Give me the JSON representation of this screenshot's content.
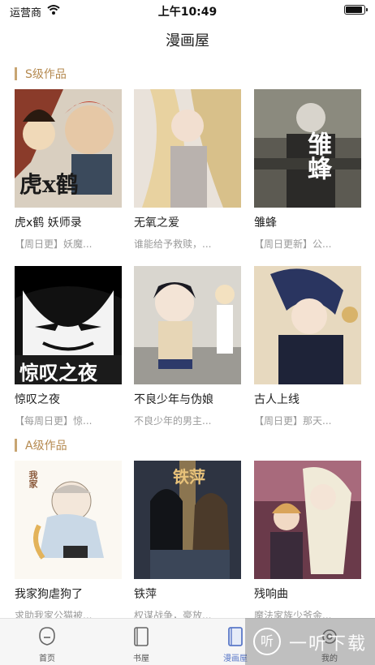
{
  "status_bar": {
    "carrier": "运营商",
    "time": "上午10:49",
    "battery_level": 0.9
  },
  "nav": {
    "title": "漫画屋"
  },
  "sections": [
    {
      "label": "S级作品",
      "items": [
        {
          "title": "虎x鹤 妖师录",
          "subtitle": "【周日更】妖魔...",
          "cover_text": "虎x鹤"
        },
        {
          "title": "无氧之爱",
          "subtitle": "谁能给予救赎，...",
          "cover_text": ""
        },
        {
          "title": "雏蜂",
          "subtitle": "【周日更新】公...",
          "cover_text": "雏蜂"
        },
        {
          "title": "惊叹之夜",
          "subtitle": "【每周日更】惊...",
          "cover_text": "惊叹之夜"
        },
        {
          "title": "不良少年与伪娘",
          "subtitle": "不良少年的男主...",
          "cover_text": ""
        },
        {
          "title": "古人上线",
          "subtitle": "【周日更】那天...",
          "cover_text": ""
        }
      ]
    },
    {
      "label": "A级作品",
      "items": [
        {
          "title": "我家狗虐狗了",
          "subtitle": "求助我家公猫被...",
          "cover_text": "我家"
        },
        {
          "title": "铁萍",
          "subtitle": "权谋战争，豪放...",
          "cover_text": "铁萍"
        },
        {
          "title": "残响曲",
          "subtitle": "魔法家族少爷金...",
          "cover_text": ""
        }
      ]
    }
  ],
  "tabs": [
    {
      "label": "首页",
      "icon": "home-icon",
      "active": false
    },
    {
      "label": "书屋",
      "icon": "bookshelf-icon",
      "active": false
    },
    {
      "label": "漫画屋",
      "icon": "comic-icon",
      "active": true
    },
    {
      "label": "我的",
      "icon": "profile-icon",
      "active": false
    }
  ],
  "watermark": {
    "glyph": "听",
    "text": "一听下载"
  },
  "colors": {
    "accent": "#c8a572",
    "section_text": "#b58a50",
    "tab_active": "#5a78c8"
  }
}
